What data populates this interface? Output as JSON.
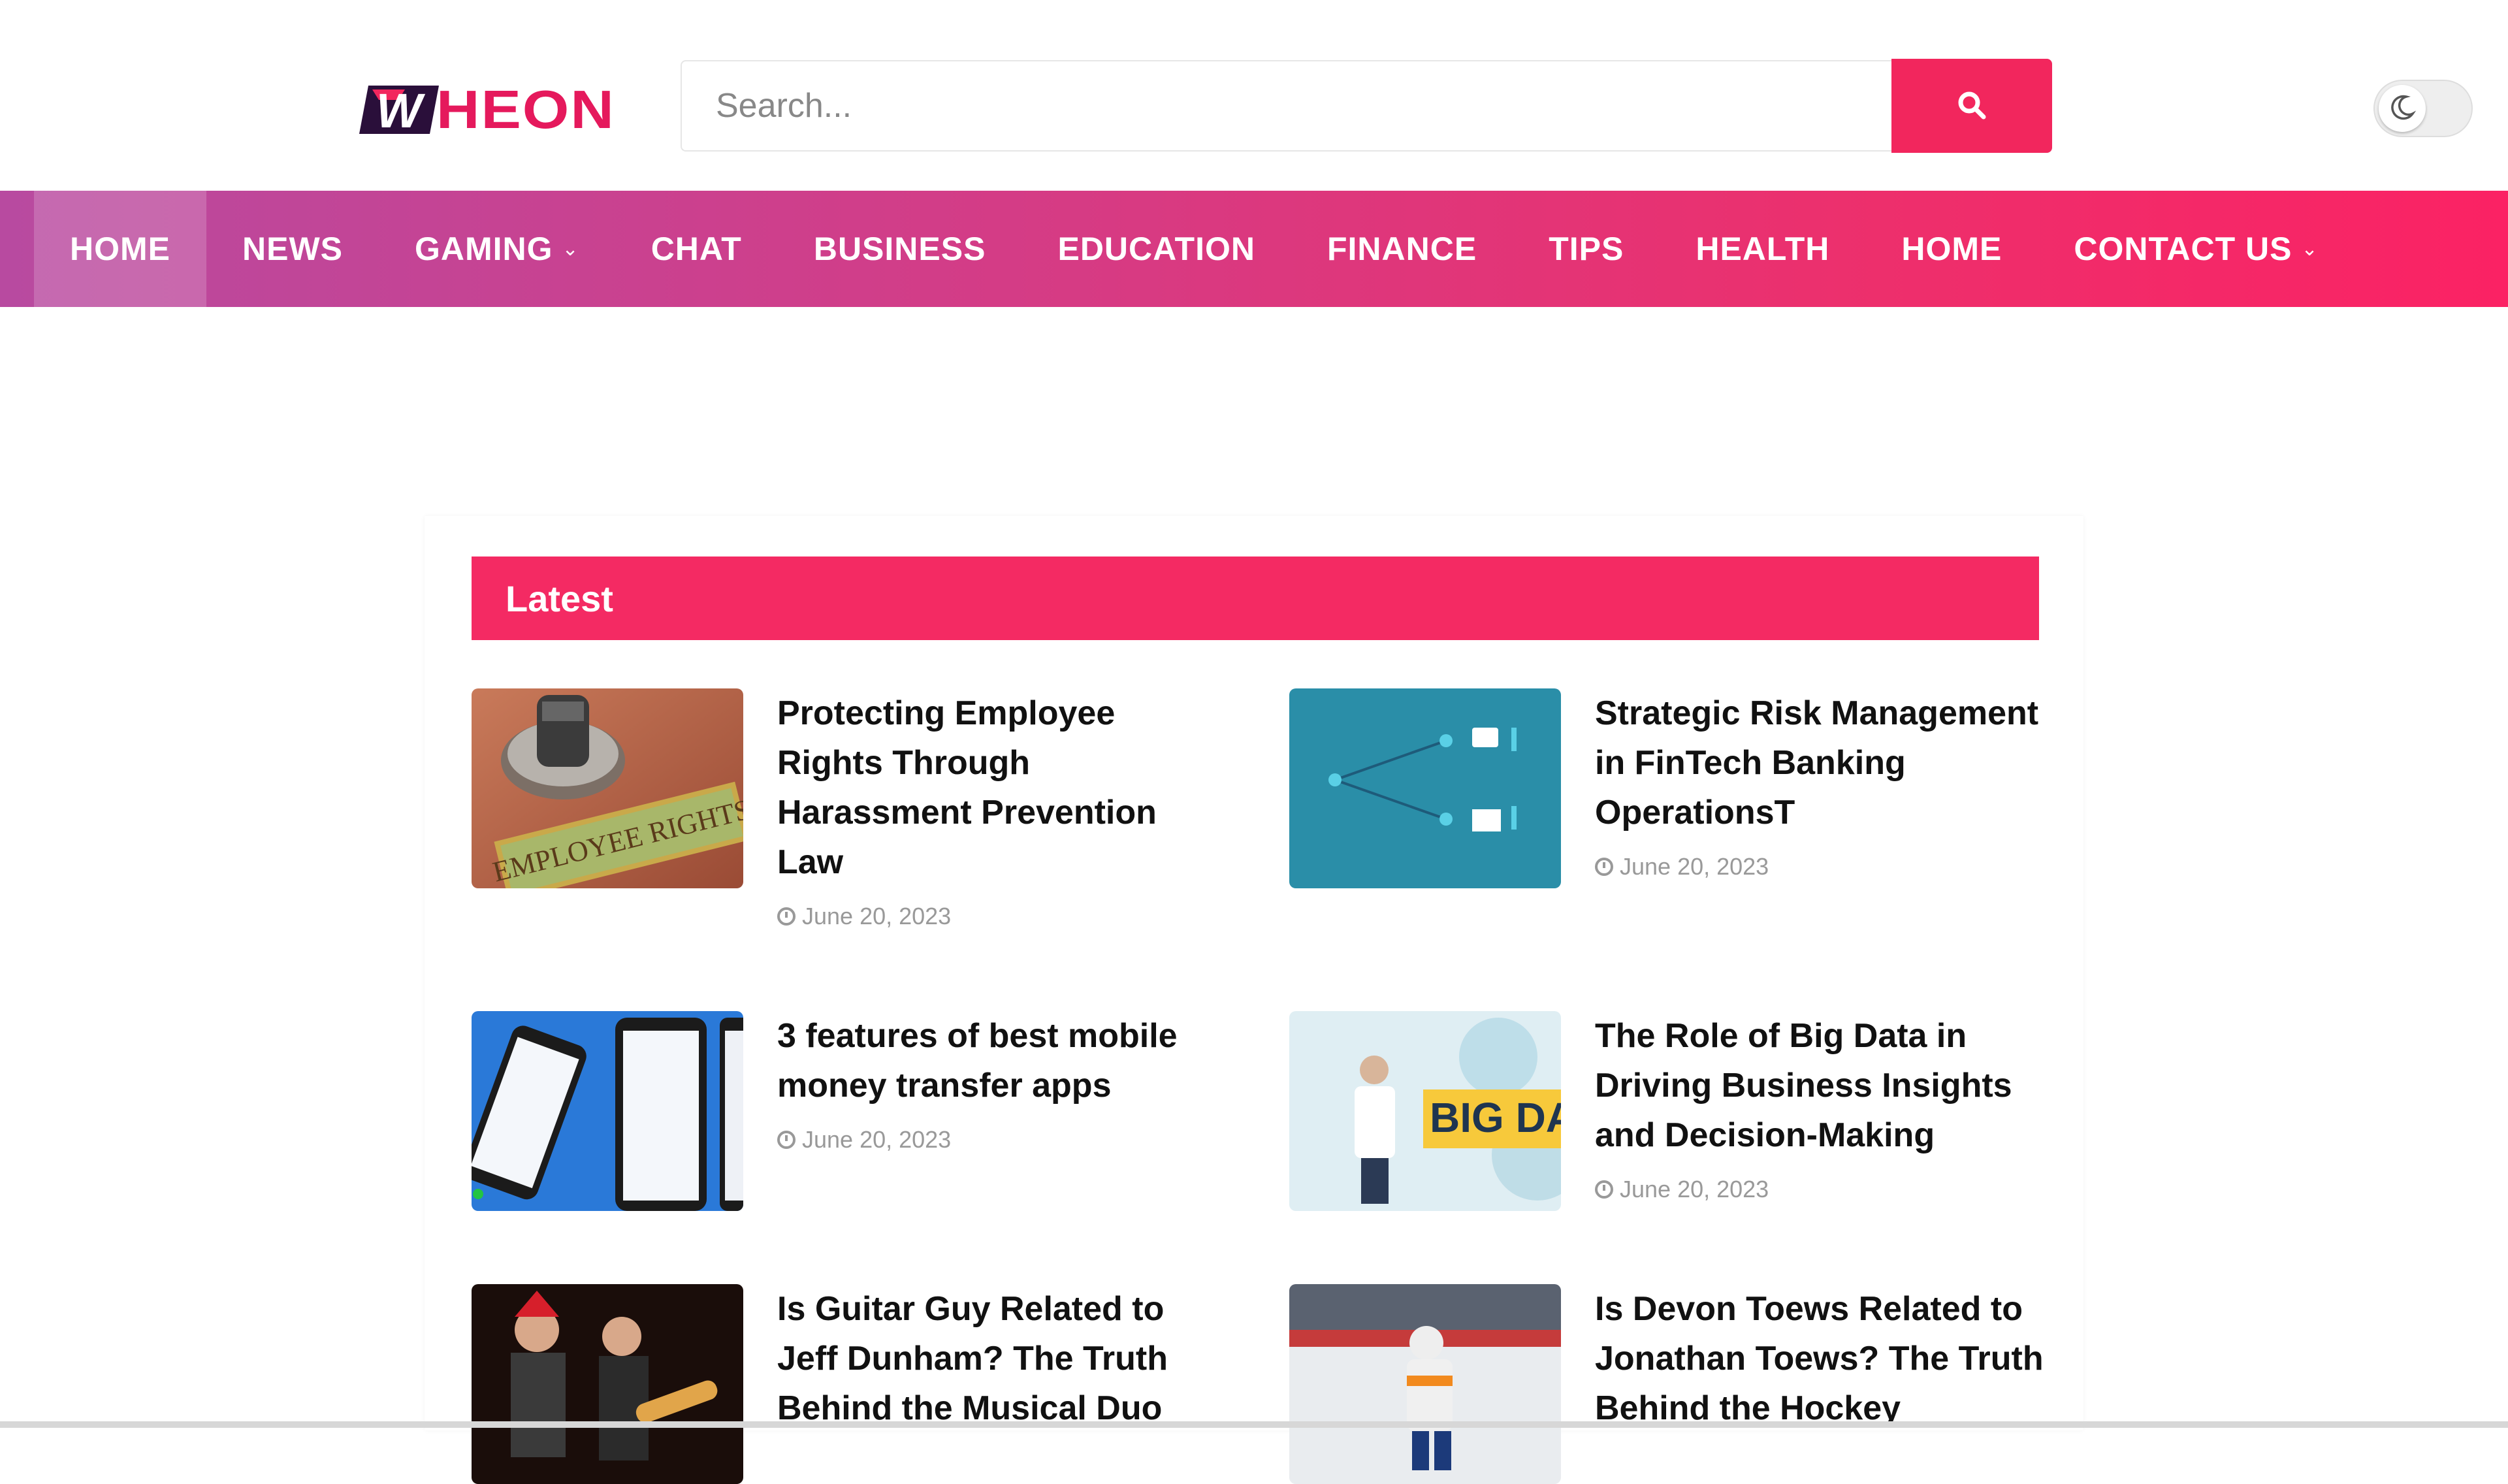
{
  "brand": {
    "logo_text": "HEON",
    "logo_mark_letter": "W",
    "accent_color": "#f2265d"
  },
  "search": {
    "placeholder": "Search...",
    "icon": "search-icon"
  },
  "toggle": {
    "icon": "moon-icon",
    "state": "off"
  },
  "nav": {
    "items": [
      {
        "label": "HOME",
        "active": true
      },
      {
        "label": "NEWS"
      },
      {
        "label": "GAMING",
        "has_dropdown": true
      },
      {
        "label": "CHAT"
      },
      {
        "label": "BUSINESS"
      },
      {
        "label": "EDUCATION"
      },
      {
        "label": "FINANCE"
      },
      {
        "label": "TIPS"
      },
      {
        "label": "HEALTH"
      },
      {
        "label": "HOME"
      },
      {
        "label": "CONTACT US",
        "has_dropdown": true
      }
    ],
    "dropdown_glyph": "⌵"
  },
  "latest": {
    "heading": "Latest",
    "posts": [
      {
        "title": "Protecting Employee Rights Through Harassment Prevention Law",
        "date": "June 20, 2023",
        "thumb_text": "EMPLOYEE RIGHTS"
      },
      {
        "title": "Strategic Risk Management in FinTech Banking OperationsT",
        "date": "June 20, 2023"
      },
      {
        "title": "3 features of best mobile money transfer apps",
        "date": "June 20, 2023"
      },
      {
        "title": "The Role of Big Data in Driving Business Insights and Decision-Making",
        "date": "June 20, 2023",
        "thumb_text": "BIG DAT"
      },
      {
        "title": "Is Guitar Guy Related to Jeff Dunham? The Truth Behind the Musical Duo",
        "date": ""
      },
      {
        "title": "Is Devon Toews Related to Jonathan Toews? The Truth Behind the Hockey",
        "date": ""
      }
    ]
  }
}
